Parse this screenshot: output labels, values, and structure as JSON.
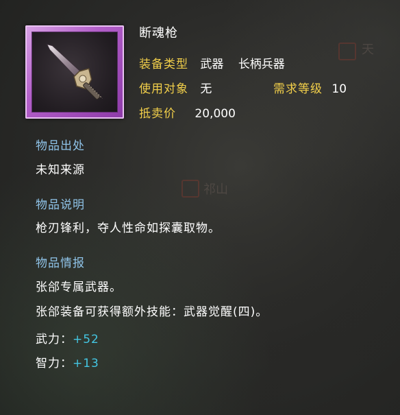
{
  "item": {
    "name": "断魂枪",
    "icon": "spear-icon",
    "frame_color": "#b35fc9"
  },
  "stats": {
    "type_label": "装备类型",
    "type_value_1": "武器",
    "type_value_2": "长柄兵器",
    "user_label": "使用对象",
    "user_value": "无",
    "level_label": "需求等级",
    "level_value": "10",
    "price_label": "抵卖价",
    "price_value": "20,000"
  },
  "sections": {
    "origin_title": "物品出处",
    "origin_text": "未知来源",
    "desc_title": "物品说明",
    "desc_text": "枪刃锋利，夺人性命如探囊取物。",
    "info_title": "物品情报",
    "info_line1": "张郃专属武器。",
    "info_line2": "张郃装备可获得额外技能：武器觉醒(四)。",
    "attr1_label": "武力：",
    "attr1_value": "+52",
    "attr2_label": "智力：",
    "attr2_value": "+13"
  },
  "colors": {
    "label_gold": "#f2cf4a",
    "section_blue": "#8fc3e8",
    "bonus_cyan": "#44c6e2"
  }
}
